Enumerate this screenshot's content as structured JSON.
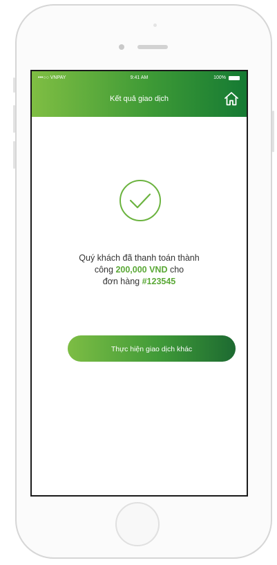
{
  "status_bar": {
    "carrier": "•••○○ VNPAY",
    "time": "9:41 AM",
    "battery": "100%"
  },
  "header": {
    "title": "Kết quả giao dịch",
    "home_icon": "home-icon"
  },
  "result": {
    "icon": "check-circle-icon",
    "line1": "Quý khách đã thanh toán thành",
    "line2_prefix": "công ",
    "amount": "200,000 VND",
    "line2_suffix": " cho",
    "line3_prefix": "đơn hàng ",
    "order_id": "#123545"
  },
  "action": {
    "label": "Thực hiện giao dịch khác"
  },
  "colors": {
    "brand_green": "#3e9a36",
    "highlight_green": "#5aa836",
    "dark_green": "#157a33"
  }
}
